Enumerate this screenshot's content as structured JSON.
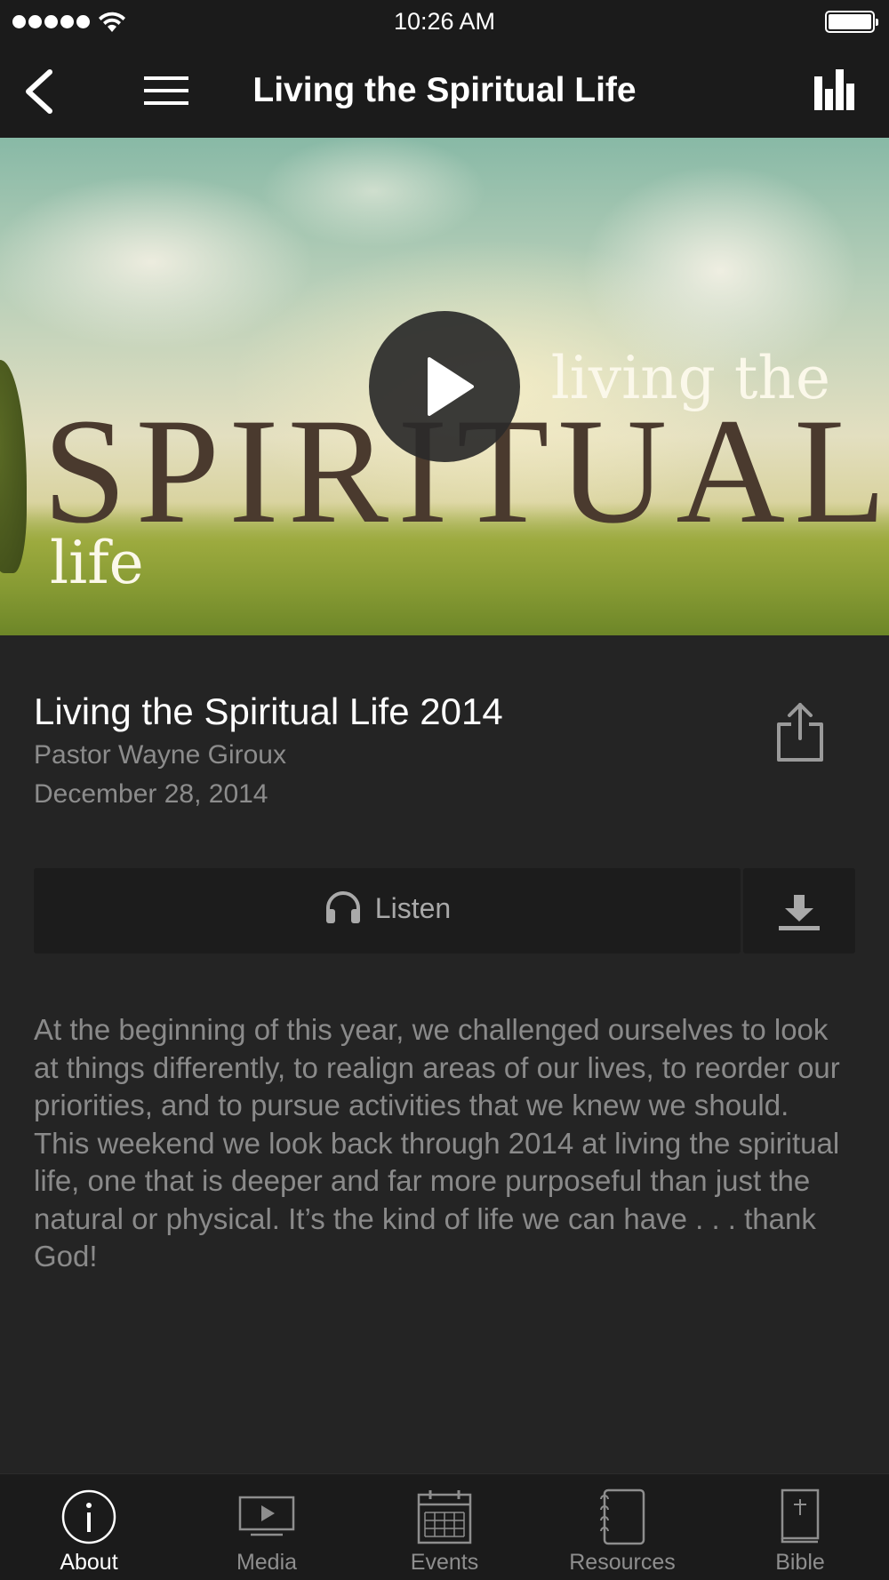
{
  "status_bar": {
    "time": "10:26 AM"
  },
  "nav": {
    "title": "Living the Spiritual Life"
  },
  "hero": {
    "line_top": "living the",
    "line_main": "SPIRITUAL",
    "line_bottom": "life"
  },
  "sermon": {
    "title": "Living the Spiritual Life 2014",
    "speaker": "Pastor Wayne Giroux",
    "date": "December 28, 2014",
    "listen_label": "Listen",
    "description": [
      "At the beginning of this year, we challenged ourselves to look at things differently, to realign areas of our lives, to reorder our priorities, and to pursue activities that we knew we should.",
      "This weekend we look back through 2014 at living the spiritual life, one that is deeper and far more purposeful than just the natural or physical. It’s the kind of life we can have . . . thank God!"
    ]
  },
  "tabs": [
    {
      "label": "About",
      "icon": "info-icon",
      "active": true
    },
    {
      "label": "Media",
      "icon": "media-icon",
      "active": false
    },
    {
      "label": "Events",
      "icon": "calendar-icon",
      "active": false
    },
    {
      "label": "Resources",
      "icon": "notebook-icon",
      "active": false
    },
    {
      "label": "Bible",
      "icon": "bible-icon",
      "active": false
    }
  ],
  "colors": {
    "background": "#242424",
    "bar": "#1b1b1b",
    "muted_text": "#8a8a8a",
    "active_tab": "#ffffff"
  }
}
